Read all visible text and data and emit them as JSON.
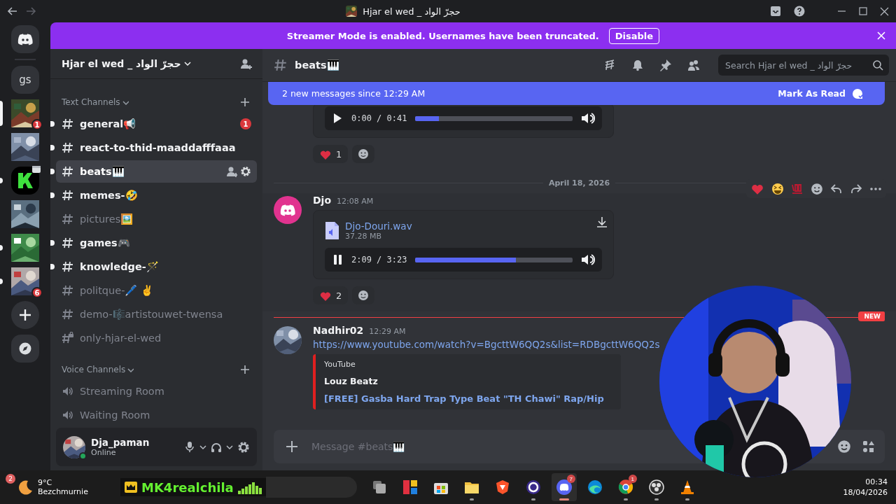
{
  "window": {
    "title": "Hjar el wed _ حجرّ الواد"
  },
  "banner": {
    "text": "Streamer Mode is enabled. Usernames have been truncated.",
    "button": "Disable"
  },
  "servers": [
    {
      "kind": "text",
      "label": "gs",
      "selected": false,
      "unread": false
    },
    {
      "kind": "picture",
      "selected": true,
      "unread": false,
      "badge": "1"
    },
    {
      "kind": "picture",
      "selected": false,
      "unread": false
    },
    {
      "kind": "logo",
      "selected": false,
      "unread": true
    },
    {
      "kind": "picture",
      "selected": false,
      "unread": false
    },
    {
      "kind": "picture",
      "selected": false,
      "unread": true
    },
    {
      "kind": "picture",
      "selected": false,
      "unread": true,
      "badge": "6"
    }
  ],
  "server_header": {
    "name": "Hjar el wed _ حجرّ الواد"
  },
  "text_channels": {
    "title": "Text Channels",
    "items": [
      {
        "kind": "text",
        "name": "general📢",
        "unread": true,
        "selected": false,
        "badge": "1"
      },
      {
        "kind": "text",
        "name": "react-to-thid-maaddafffaaa",
        "unread": true,
        "selected": false
      },
      {
        "kind": "text",
        "name": "beats🎹",
        "unread": true,
        "selected": true
      },
      {
        "kind": "text",
        "name": "memes-🤣",
        "unread": true,
        "selected": false
      },
      {
        "kind": "text",
        "name": "pictures🖼️",
        "unread": false,
        "selected": false
      },
      {
        "kind": "text",
        "name": "games🎮",
        "unread": true,
        "selected": false
      },
      {
        "kind": "text",
        "name": "knowledge-🪄",
        "unread": true,
        "selected": false
      },
      {
        "kind": "text",
        "name": "politque-🖊️ ✌️",
        "unread": false,
        "selected": false
      },
      {
        "kind": "text",
        "name": "demo-🎼artistouwet-twensa",
        "unread": false,
        "selected": false
      },
      {
        "kind": "locked",
        "name": "only-hjar-el-wed",
        "unread": false,
        "selected": false
      }
    ]
  },
  "voice_channels": {
    "title": "Voice Channels",
    "items": [
      {
        "name": "Streaming Room"
      },
      {
        "name": "Waiting Room"
      }
    ]
  },
  "user": {
    "name": "Dja_paman",
    "status": "Online"
  },
  "channel_header": {
    "name": "beats🎹",
    "search_placeholder": "Search Hjar el wed _ حجرّ الواد"
  },
  "new_messages": {
    "text": "2 new messages since 12:29 AM",
    "action": "Mark As Read"
  },
  "messages": [
    {
      "kind": "audio_tail",
      "player": {
        "playing": false,
        "time": "0:00 / 0:41",
        "level": 0.15
      },
      "reactions": [
        {
          "count": "1"
        }
      ]
    },
    {
      "kind": "divider",
      "text": "April 18, 2026"
    },
    {
      "kind": "attachment",
      "author": "Djo",
      "time": "12:08 AM",
      "hovered": true,
      "file": {
        "name": "Djo-Douri.wav",
        "size": "37.28 MB"
      },
      "player": {
        "playing": true,
        "time": "2:09 / 3:23",
        "level": 0.64
      },
      "reactions": [
        {
          "count": "2"
        }
      ]
    },
    {
      "kind": "new_divider",
      "text": "NEW"
    },
    {
      "kind": "link",
      "author": "Nadhir02",
      "time": "12:29 AM",
      "link": "https://www.youtube.com/watch?v=BgcttW6QQ2s&list=RDBgcttW6QQ2s",
      "embed": {
        "provider": "YouTube",
        "author": "Louz Beatz",
        "title": "[FREE] Gasba Hard Trap Type Beat \"TH Chawi\" Rap/Hip"
      }
    }
  ],
  "composer": {
    "placeholder": "Message #beats🎹"
  },
  "taskbar": {
    "weather": {
      "temp": "9°C",
      "desc": "Bezchmurnie",
      "badge": "2"
    },
    "overlay": {
      "text": "MK4realchila"
    },
    "apps": [
      {
        "running": false,
        "active": false
      },
      {
        "running": false,
        "active": false
      },
      {
        "running": false,
        "active": false
      },
      {
        "running": true,
        "active": false
      },
      {
        "running": false,
        "active": false
      },
      {
        "running": true,
        "active": false
      },
      {
        "running": true,
        "active": true,
        "badge": "7"
      },
      {
        "running": false,
        "active": false
      },
      {
        "running": true,
        "active": false,
        "badge": "1"
      },
      {
        "running": true,
        "active": false
      },
      {
        "running": true,
        "active": false
      }
    ],
    "time": "00:34",
    "date": "18/04/2026"
  }
}
